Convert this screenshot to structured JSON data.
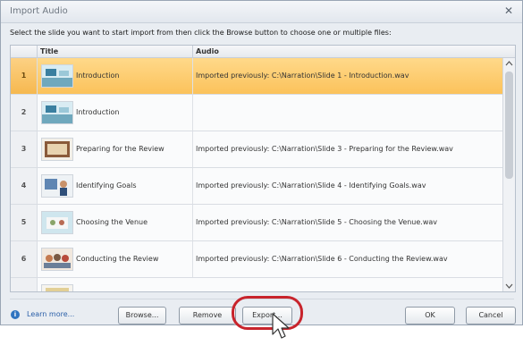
{
  "dialog": {
    "title": "Import Audio",
    "close_glyph": "✕",
    "instructions": "Select the slide you want to start import from then click the Browse button to choose one or multiple files:"
  },
  "grid": {
    "columns": [
      "Title",
      "Audio"
    ],
    "rows": [
      {
        "num": "1",
        "title": "Introduction",
        "audio": "Imported previously: C:\\Narration\\Slide 1 - Introduction.wav",
        "thumb_icon": "slide-thumbnail-icon",
        "selected": true
      },
      {
        "num": "2",
        "title": "Introduction",
        "audio": "",
        "thumb_icon": "slide-thumbnail-icon",
        "selected": false
      },
      {
        "num": "3",
        "title": "Preparing for the Review",
        "audio": "Imported previously: C:\\Narration\\Slide 3 - Preparing for the Review.wav",
        "thumb_icon": "slide-thumbnail-icon",
        "selected": false
      },
      {
        "num": "4",
        "title": "Identifying Goals",
        "audio": "Imported previously: C:\\Narration\\Slide 4 - Identifying Goals.wav",
        "thumb_icon": "slide-thumbnail-icon",
        "selected": false
      },
      {
        "num": "5",
        "title": "Choosing the Venue",
        "audio": "Imported previously: C:\\Narration\\Slide 5 - Choosing the Venue.wav",
        "thumb_icon": "slide-thumbnail-icon",
        "selected": false
      },
      {
        "num": "6",
        "title": "Conducting the Review",
        "audio": "Imported previously: C:\\Narration\\Slide 6 - Conducting the Review.wav",
        "thumb_icon": "slide-thumbnail-icon",
        "selected": false
      }
    ]
  },
  "footer": {
    "learn_more": "Learn more...",
    "info_icon": "info-icon",
    "browse": "Browse...",
    "remove": "Remove",
    "export": "Export...",
    "ok": "OK",
    "cancel": "Cancel"
  },
  "colors": {
    "selected_row": "#fbc25b",
    "highlight_ring": "#c8242c",
    "link": "#2a5fa8"
  }
}
